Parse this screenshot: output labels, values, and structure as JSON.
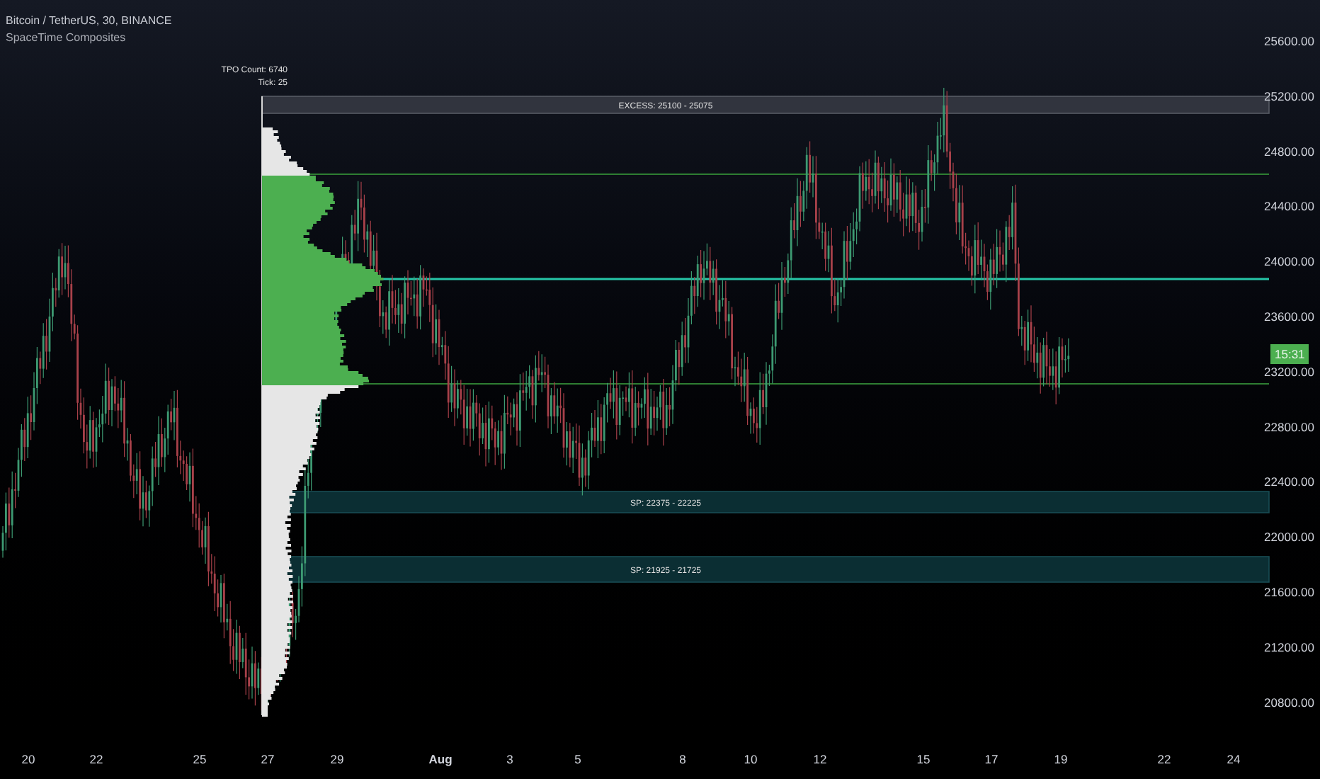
{
  "legend": {
    "symbol": "Bitcoin / TetherUS, 30, BINANCE",
    "indicator": "SpaceTime Composites"
  },
  "profile": {
    "tpo_count": "TPO Count: 6740",
    "tick": "Tick: 25"
  },
  "zones": [
    {
      "kind": "excess",
      "label": "EXCESS: 25100 - 25075"
    },
    {
      "kind": "single_print",
      "label": "SP: 22375 - 22225"
    },
    {
      "kind": "single_print",
      "label": "SP: 21925 - 21725"
    }
  ],
  "price_axis": {
    "labels": [
      "25600.00",
      "25200.00",
      "24800.00",
      "24400.00",
      "24000.00",
      "23600.00",
      "23200.00",
      "22800.00",
      "22400.00",
      "22000.00",
      "21600.00",
      "21200.00",
      "20800.00"
    ],
    "last_price_tag": "15:31"
  },
  "time_axis": [
    {
      "label": "20",
      "kind": "day"
    },
    {
      "label": "22",
      "kind": "day"
    },
    {
      "label": "25",
      "kind": "day"
    },
    {
      "label": "27",
      "kind": "day"
    },
    {
      "label": "29",
      "kind": "day"
    },
    {
      "label": "Aug",
      "kind": "month"
    },
    {
      "label": "3",
      "kind": "day"
    },
    {
      "label": "5",
      "kind": "day"
    },
    {
      "label": "8",
      "kind": "day"
    },
    {
      "label": "10",
      "kind": "day"
    },
    {
      "label": "12",
      "kind": "day"
    },
    {
      "label": "15",
      "kind": "day"
    },
    {
      "label": "17",
      "kind": "day"
    },
    {
      "label": "19",
      "kind": "day"
    },
    {
      "label": "22",
      "kind": "day"
    },
    {
      "label": "24",
      "kind": "day"
    }
  ]
}
